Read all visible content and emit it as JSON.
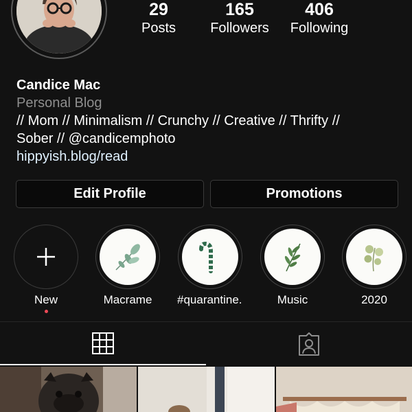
{
  "profile": {
    "stats": [
      {
        "value": "29",
        "label": "Posts"
      },
      {
        "value": "165",
        "label": "Followers"
      },
      {
        "value": "406",
        "label": "Following"
      }
    ],
    "name": "Candice Mac",
    "category": "Personal Blog",
    "bio_line1": "// Mom // Minimalism // Crunchy // Creative // Thrifty //",
    "bio_line2": "Sober // @candicemphoto",
    "link": "hippyish.blog/read"
  },
  "buttons": {
    "edit": "Edit Profile",
    "promotions": "Promotions"
  },
  "highlights": [
    {
      "label": "New",
      "icon": "plus-icon"
    },
    {
      "label": "Macrame",
      "icon": "leaf-sprig-icon"
    },
    {
      "label": "#quarantine...",
      "icon": "candy-cane-icon"
    },
    {
      "label": "Music",
      "icon": "fern-icon"
    },
    {
      "label": "2020",
      "icon": "eucalyptus-icon"
    }
  ],
  "tabs": [
    {
      "name": "posts-grid",
      "icon": "grid-icon",
      "active": true
    },
    {
      "name": "tagged",
      "icon": "tagged-person-icon",
      "active": false
    }
  ],
  "colors": {
    "background": "#121212",
    "secondary_text": "#8e8e8e",
    "notification_dot": "#ed4956",
    "link": "#e0f1ff"
  }
}
